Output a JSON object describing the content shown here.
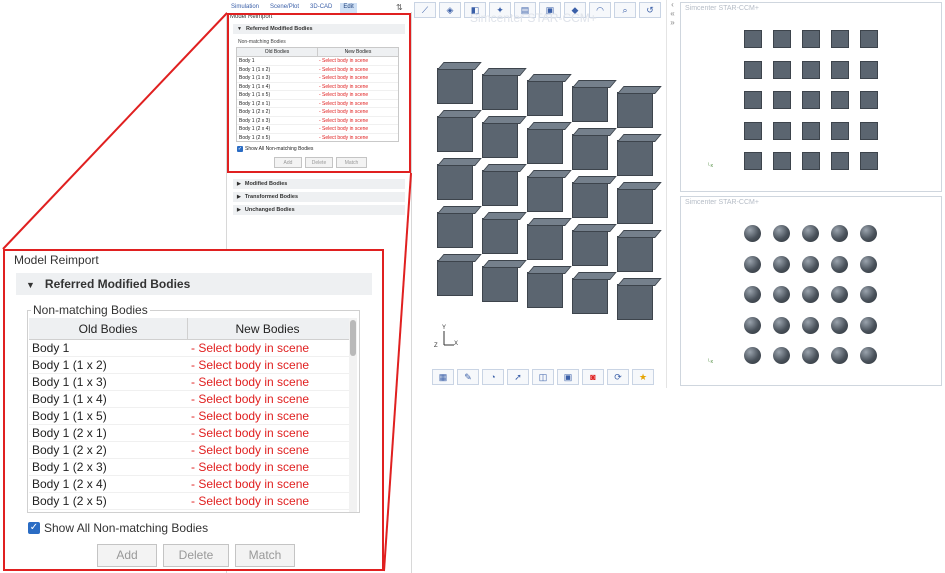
{
  "small_panel": {
    "tabs": [
      {
        "label": "Simulation",
        "active": false
      },
      {
        "label": "Scene/Plot",
        "active": false
      },
      {
        "label": "3D-CAD",
        "active": false
      },
      {
        "label": "Edit",
        "active": true
      }
    ],
    "title": "Model Reimport",
    "referred_group": "Referred Modified Bodies",
    "non_matching_label": "Non-matching Bodies",
    "columns": [
      "Old Bodies",
      "New Bodies"
    ],
    "rows": [
      {
        "old": "Body 1",
        "new": "- Select body in scene"
      },
      {
        "old": "Body 1 (1 x 2)",
        "new": "- Select body in scene"
      },
      {
        "old": "Body 1 (1 x 3)",
        "new": "- Select body in scene"
      },
      {
        "old": "Body 1 (1 x 4)",
        "new": "- Select body in scene"
      },
      {
        "old": "Body 1 (1 x 5)",
        "new": "- Select body in scene"
      },
      {
        "old": "Body 1 (2 x 1)",
        "new": "- Select body in scene"
      },
      {
        "old": "Body 1 (2 x 2)",
        "new": "- Select body in scene"
      },
      {
        "old": "Body 1 (2 x 3)",
        "new": "- Select body in scene"
      },
      {
        "old": "Body 1 (2 x 4)",
        "new": "- Select body in scene"
      },
      {
        "old": "Body 1 (2 x 5)",
        "new": "- Select body in scene"
      }
    ],
    "show_all_label": "Show All Non-matching Bodies",
    "show_all_checked": true,
    "buttons": {
      "add": "Add",
      "delete": "Delete",
      "match": "Match"
    },
    "other_groups": [
      "Modified Bodies",
      "Transformed Bodies",
      "Unchanged Bodies"
    ]
  },
  "zoom_panel": {
    "title": "Model Reimport",
    "referred_group": "Referred Modified Bodies",
    "non_matching_label": "Non-matching Bodies",
    "columns": [
      "Old Bodies",
      "New Bodies"
    ],
    "rows": [
      {
        "old": "Body 1",
        "new": "- Select body in scene"
      },
      {
        "old": "Body 1 (1 x 2)",
        "new": "- Select body in scene"
      },
      {
        "old": "Body 1 (1 x 3)",
        "new": "- Select body in scene"
      },
      {
        "old": "Body 1 (1 x 4)",
        "new": "- Select body in scene"
      },
      {
        "old": "Body 1 (1 x 5)",
        "new": "- Select body in scene"
      },
      {
        "old": "Body 1 (2 x 1)",
        "new": "- Select body in scene"
      },
      {
        "old": "Body 1 (2 x 2)",
        "new": "- Select body in scene"
      },
      {
        "old": "Body 1 (2 x 3)",
        "new": "- Select body in scene"
      },
      {
        "old": "Body 1 (2 x 4)",
        "new": "- Select body in scene"
      },
      {
        "old": "Body 1 (2 x 5)",
        "new": "- Select body in scene"
      }
    ],
    "show_all_label": "Show All Non-matching Bodies",
    "show_all_checked": true,
    "buttons": {
      "add": "Add",
      "delete": "Delete",
      "match": "Match"
    }
  },
  "scene": {
    "watermark": "Simcenter STAR-CCM+",
    "axis_labels": {
      "y": "Y",
      "x": "X",
      "z": "Z"
    },
    "cube_rows": 5,
    "cube_cols": 5
  },
  "views": [
    {
      "title": "Simcenter STAR-CCM+",
      "shape": "square",
      "rows": 5,
      "cols": 5
    },
    {
      "title": "Simcenter STAR-CCM+",
      "shape": "sphere",
      "rows": 5,
      "cols": 5
    }
  ],
  "colors": {
    "highlight": "#e02020",
    "body_fill": "#5b6570",
    "accent": "#2a6cc4"
  }
}
